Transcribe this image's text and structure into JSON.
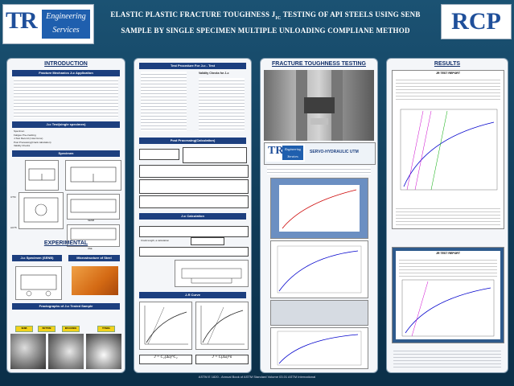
{
  "header": {
    "line1": "ELASTIC PLASTIC FRACTURE TOUGHNESS  J",
    "line1_sub": "IC",
    "line1_end": " TESTING OF API STEELS USING SENB",
    "line2": "SAMPLE BY SINGLE SPECIMEN MULTIPLE UNLOADING COMPLIANE METHOD",
    "logo_left_mark": "TR",
    "logo_left_text_1": "Engineering",
    "logo_left_text_2": "Services",
    "logo_right": "RCP"
  },
  "col1": {
    "intro": "INTRODUCTION",
    "band1": "Fracture Mechanics J₁c Application",
    "band2": "J₁c Test(single specimen)",
    "list2": [
      "Specimen",
      "Fatigue Pre-cracking",
      "J-Test Record (J-Δa Curve)",
      "Post Processing(Crack calculation)",
      "Validity Checks"
    ],
    "band3": "Specimen",
    "exp": "EXPERIMENTAL",
    "band4a": "J₁c Specimen (SENB)",
    "band4b": "Microstructure of Steel",
    "band5": "Fractographs of J₁c Tested Sample",
    "labels": [
      "UTM",
      "AUT5",
      "SENB",
      "3SE"
    ],
    "tags": [
      "SENB",
      "BOTTOM",
      "INFLUENCE",
      "TITANIA"
    ]
  },
  "col2": {
    "band1": "Test Procedure For J₁c - Test",
    "validity": "Validity Checks for J₁c",
    "band2": "Post Processing(Calculation)",
    "band3": "J₁c Calculation",
    "band4": "J-R Curve",
    "crack_extension": "Crack length, a calculation",
    "f1": "J = C₁(Δa)^C₂",
    "f2": "J = C(Δa)^n"
  },
  "col3": {
    "title": "FRACTURE TOUGHNESS TESTING",
    "banner": "SERVO-HYDRAULIC UTM",
    "banner_logo": "TR",
    "banner_logo_text_1": "Engineering",
    "banner_logo_text_2": "Services"
  },
  "col4": {
    "title": "RESULTS",
    "report1": "JR TEST REPORT",
    "report2": "JR TEST REPORT"
  },
  "footer": "ASTM E 1820 - Annual Book of ASTM Standard Volume 03.01 ASTM International"
}
